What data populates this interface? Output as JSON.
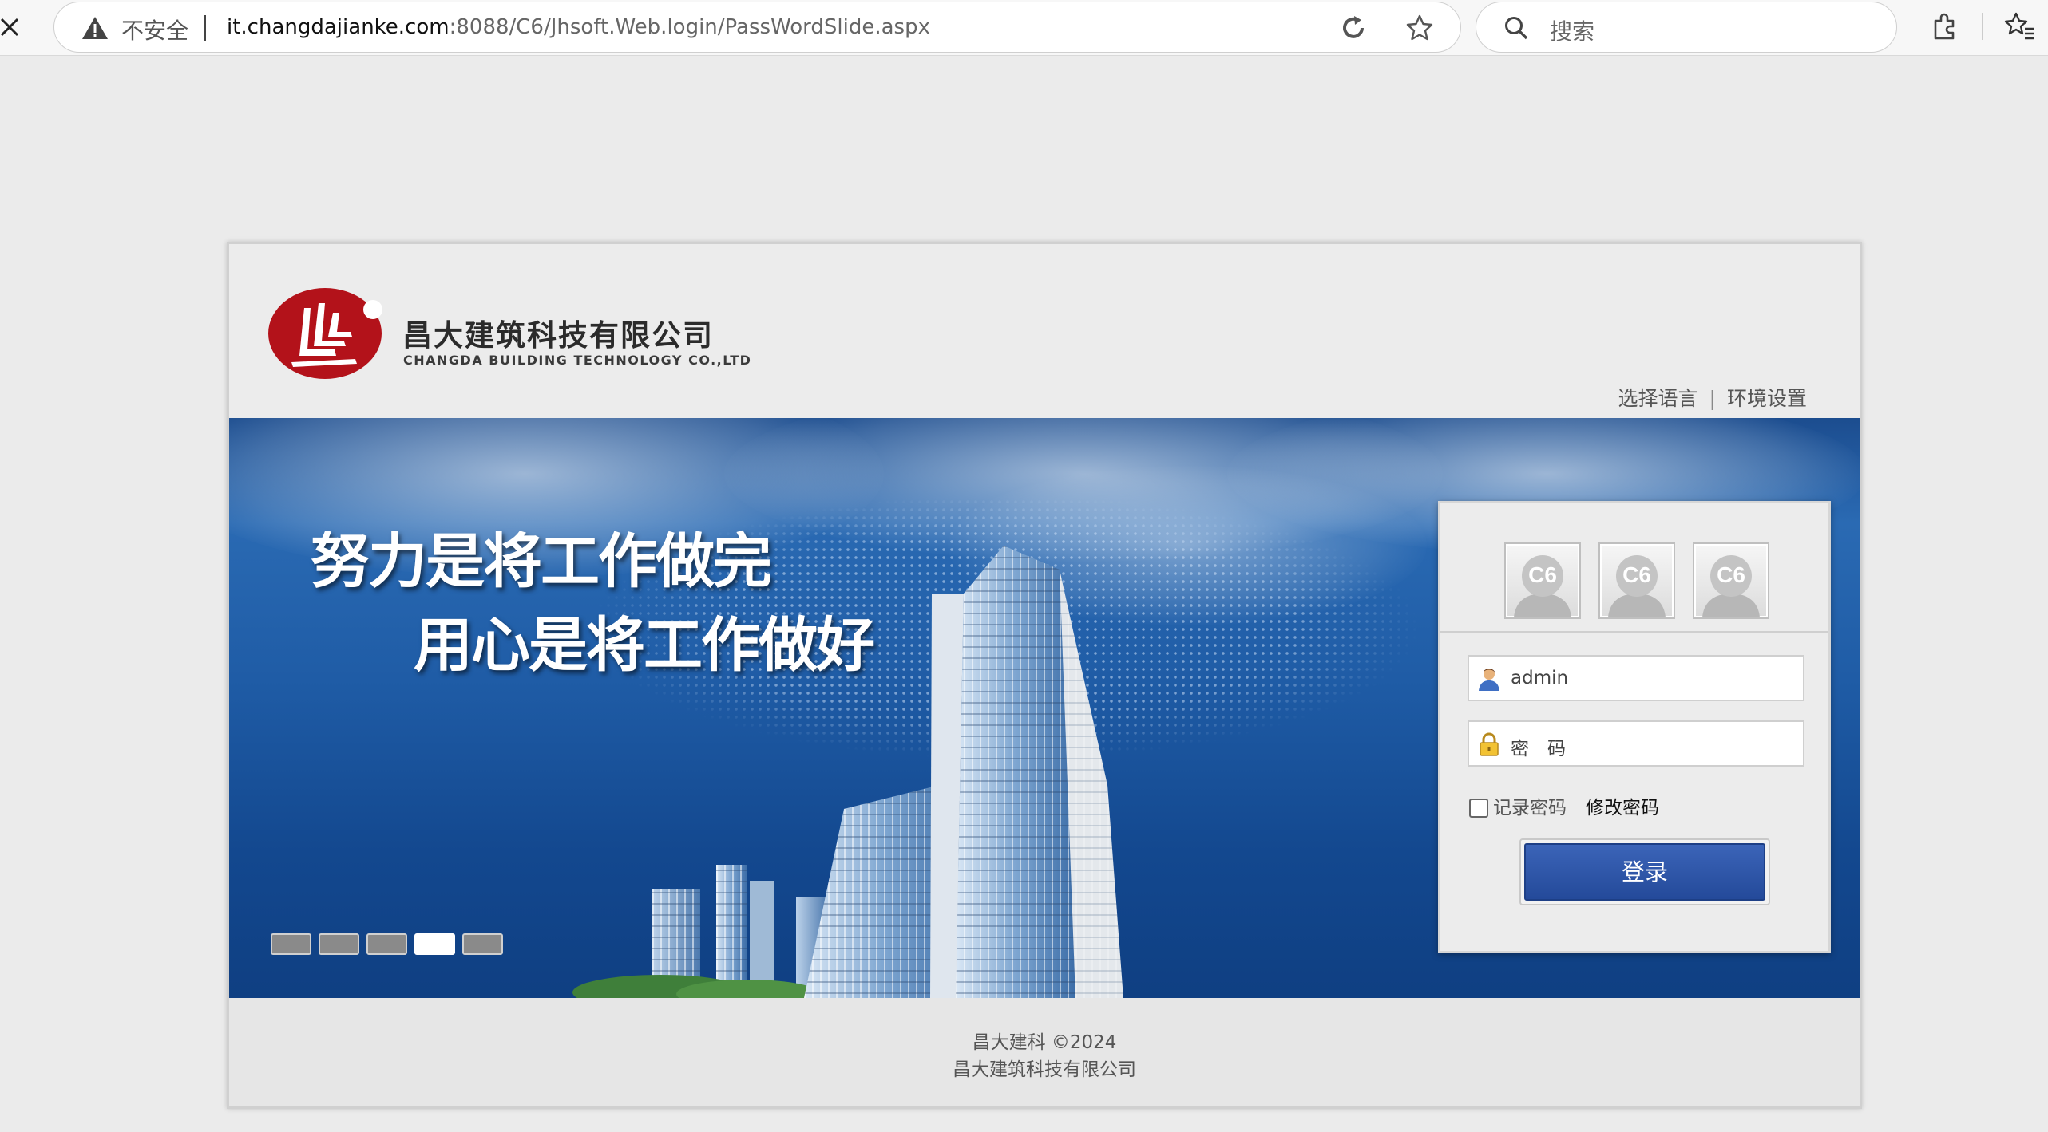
{
  "browser": {
    "security_label": "不安全",
    "url_host": "it.changdajianke.com",
    "url_rest": ":8088/C6/Jhsoft.Web.login/PassWordSlide.aspx",
    "search_placeholder": "搜索"
  },
  "header": {
    "company_cn": "昌大建筑科技有限公司",
    "company_en": "CHANGDA BUILDING TECHNOLOGY CO.,LTD",
    "links": {
      "language": "选择语言",
      "separator": "|",
      "settings": "环境设置"
    }
  },
  "banner": {
    "slogan_line1": "努力是将工作做完",
    "slogan_line2": "用心是将工作做好",
    "slides_count": 5,
    "active_slide": 4
  },
  "login": {
    "avatar_label": "C6",
    "username_value": "admin",
    "password_placeholder": "密　码",
    "remember_label": "记录密码",
    "change_password_label": "修改密码",
    "submit_label": "登录",
    "remember_checked": false
  },
  "footer": {
    "line1": "昌大建科 ©2024",
    "line2": "昌大建筑科技有限公司"
  },
  "colors": {
    "brand_red": "#b3121a",
    "banner_blue": "#1f5ca6",
    "button_blue": "#2c54a8"
  }
}
